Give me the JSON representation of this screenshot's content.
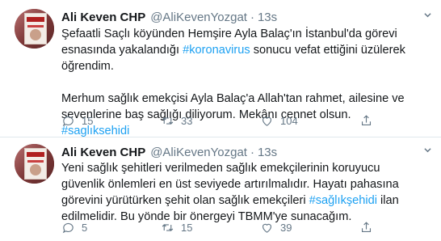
{
  "tweets": [
    {
      "name": "Ali Keven CHP",
      "handle": "@AliKevenYozgat",
      "separator": "·",
      "time": "13s",
      "paragraphs": [
        [
          "Şefaatli Saçlı köyünden Hemşire Ayla Balaç'ın İstanbul'da görevi esnasında yakalandığı ",
          "#koronavirus",
          " sonucu vefat ettiğini üzülerek öğrendim."
        ],
        [
          "Merhum sağlık emekçisi Ayla Balaç'a Allah'tan rahmet, ailesine ve sevenlerine baş sağlığı diliyorum. Mekânı cennet olsun."
        ],
        [
          "",
          "#saglıksehidi",
          ""
        ]
      ],
      "replies": "15",
      "retweets": "33",
      "likes": "104"
    },
    {
      "name": "Ali Keven CHP",
      "handle": "@AliKevenYozgat",
      "separator": "·",
      "time": "13s",
      "paragraphs": [
        [
          "Yeni sağlık şehitleri verilmeden sağlık emekçilerinin koruyucu güvenlik önlemleri en üst seviyede artırılmalıdır. Hayatı pahasına görevini yürütürken şehit olan sağlık emekçileri ",
          "#sağlıkşehidi",
          " ilan edilmelidir. Bu yönde bir önergeyi TBMM'ye sunacağım."
        ]
      ],
      "replies": "5",
      "retweets": "15",
      "likes": "39"
    }
  ],
  "colors": {
    "link": "#1da1f2",
    "muted": "#657786",
    "text": "#14171a",
    "divider": "#e1e8ed"
  },
  "icons": [
    "reply-icon",
    "retweet-icon",
    "like-icon",
    "share-icon",
    "chevron-down-icon"
  ]
}
